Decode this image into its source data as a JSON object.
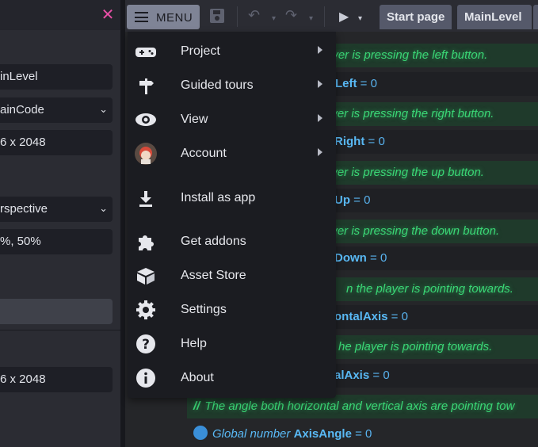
{
  "left_panel": {
    "close_glyph": "✕",
    "fields": [
      {
        "value": "inLevel",
        "has_dropdown": false
      },
      {
        "value": "ainCode",
        "has_dropdown": true
      },
      {
        "value": "6 x 2048",
        "has_dropdown": false
      },
      {
        "value": "rspective",
        "has_dropdown": true
      },
      {
        "value": "%, 50%",
        "has_dropdown": false
      },
      {
        "value": "",
        "has_dropdown": false
      },
      {
        "value": "6 x 2048",
        "has_dropdown": false
      }
    ]
  },
  "toolbar": {
    "menu_label": "MENU",
    "tabs": [
      "Start page",
      "MainLevel"
    ]
  },
  "menu": {
    "items": [
      {
        "label": "Project",
        "icon": "gamepad-icon",
        "submenu": true
      },
      {
        "label": "Guided tours",
        "icon": "signpost-icon",
        "submenu": true
      },
      {
        "label": "View",
        "icon": "eye-icon",
        "submenu": true
      },
      {
        "label": "Account",
        "icon": "avatar-icon",
        "submenu": true
      },
      {
        "label": "Install as app",
        "icon": "download-icon",
        "submenu": false
      },
      {
        "label": "Get addons",
        "icon": "puzzle-icon",
        "submenu": false
      },
      {
        "label": "Asset Store",
        "icon": "box-icon",
        "submenu": false
      },
      {
        "label": "Settings",
        "icon": "gear-icon",
        "submenu": false
      },
      {
        "label": "Help",
        "icon": "help-icon",
        "submenu": false
      },
      {
        "label": "About",
        "icon": "info-icon",
        "submenu": false
      }
    ]
  },
  "events": {
    "rows": [
      {
        "kind": "comment",
        "text": "ayer is pressing the left button."
      },
      {
        "kind": "var",
        "name": "Left",
        "value": "0"
      },
      {
        "kind": "comment",
        "text": "ayer is pressing the right button."
      },
      {
        "kind": "var",
        "name": "Right",
        "value": "0"
      },
      {
        "kind": "comment",
        "text": "ayer is pressing the up button."
      },
      {
        "kind": "var",
        "name": "Up",
        "value": "0"
      },
      {
        "kind": "comment",
        "text": "ayer is pressing the down button."
      },
      {
        "kind": "var",
        "name": "Down",
        "value": "0"
      },
      {
        "kind": "comment",
        "text": "n the player is pointing towards."
      },
      {
        "kind": "var",
        "name": "ontalAxis",
        "value": "0"
      },
      {
        "kind": "comment",
        "text": "he player is pointing towards."
      },
      {
        "kind": "var",
        "name": "alAxis",
        "value": "0"
      }
    ],
    "full_comment": {
      "slashes": "//",
      "text": "The angle both horizontal and vertical axis are pointing tow"
    },
    "full_var": {
      "prefix": "Global number",
      "name": "AxisAngle",
      "eq": "=",
      "value": "0"
    }
  },
  "colors": {
    "comment_text": "#3ad675",
    "var_text": "#59b9f5",
    "close_x": "#e84fa6",
    "menu_button": "#7f8496"
  }
}
